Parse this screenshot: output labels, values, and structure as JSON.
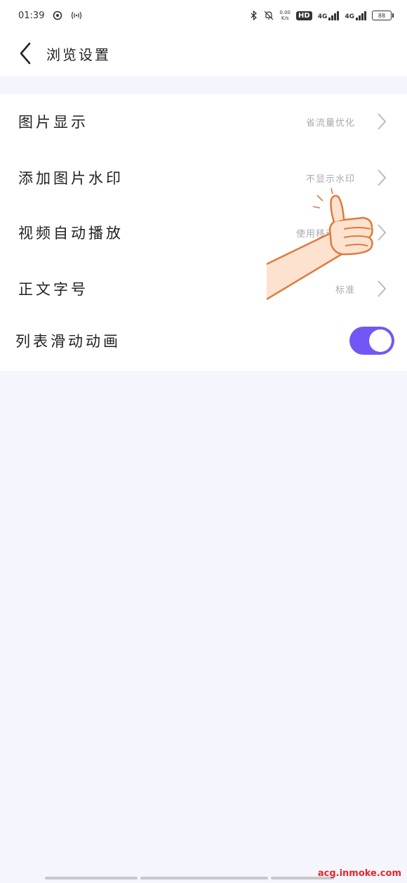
{
  "status_bar": {
    "time": "01:39",
    "net_speed": "0.00",
    "net_unit": "K/s",
    "hd": "HD",
    "network_1": "4G",
    "network_2": "4G",
    "battery": "88"
  },
  "nav": {
    "title": "浏览设置"
  },
  "settings": [
    {
      "label": "图片显示",
      "value": "省流量优化"
    },
    {
      "label": "添加图片水印",
      "value": "不显示水印"
    },
    {
      "label": "视频自动播放",
      "value": "使用移动流量"
    },
    {
      "label": "正文字号",
      "value": "标准"
    },
    {
      "label": "列表滑动动画",
      "toggle": true
    }
  ],
  "colors": {
    "accent": "#7456f5",
    "background": "#f5f6fd",
    "value_text": "#aaaaaa"
  },
  "watermark": "acg.inmoke.com"
}
